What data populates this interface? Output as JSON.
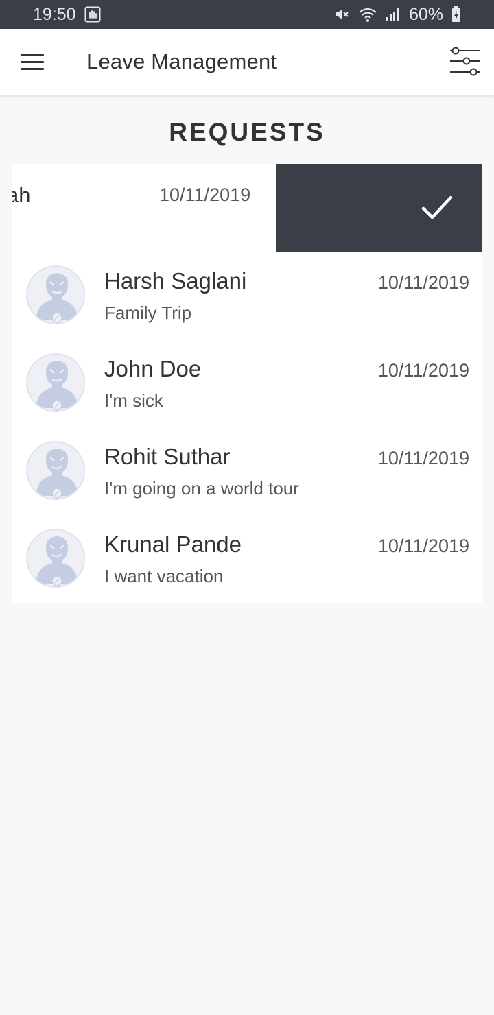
{
  "status_bar": {
    "time": "19:50",
    "battery": "60%",
    "icons": [
      "gesture-icon",
      "mute-icon",
      "wifi-icon",
      "signal-icon",
      "battery-icon"
    ]
  },
  "appbar": {
    "title": "Leave Management",
    "menu_icon": "hamburger-menu-icon",
    "filter_icon": "filter-sliders-icon"
  },
  "section": {
    "title": "REQUESTS"
  },
  "swiped_item": {
    "name_fragment": "ah",
    "date": "10/11/2019",
    "action_icon": "check-icon"
  },
  "requests": [
    {
      "name": "Harsh Saglani",
      "reason": "Family Trip",
      "date": "10/11/2019"
    },
    {
      "name": "John Doe",
      "reason": "I'm sick",
      "date": "10/11/2019"
    },
    {
      "name": "Rohit Suthar",
      "reason": "I'm going on a world tour",
      "date": "10/11/2019"
    },
    {
      "name": "Krunal Pande",
      "reason": "I want vacation",
      "date": "10/11/2019"
    }
  ],
  "colors": {
    "status_bar": "#3a3e47",
    "swipe_action": "#3a3e47",
    "background": "#f8f8f8",
    "card": "#ffffff",
    "avatar_tint": "#c5cde3"
  }
}
